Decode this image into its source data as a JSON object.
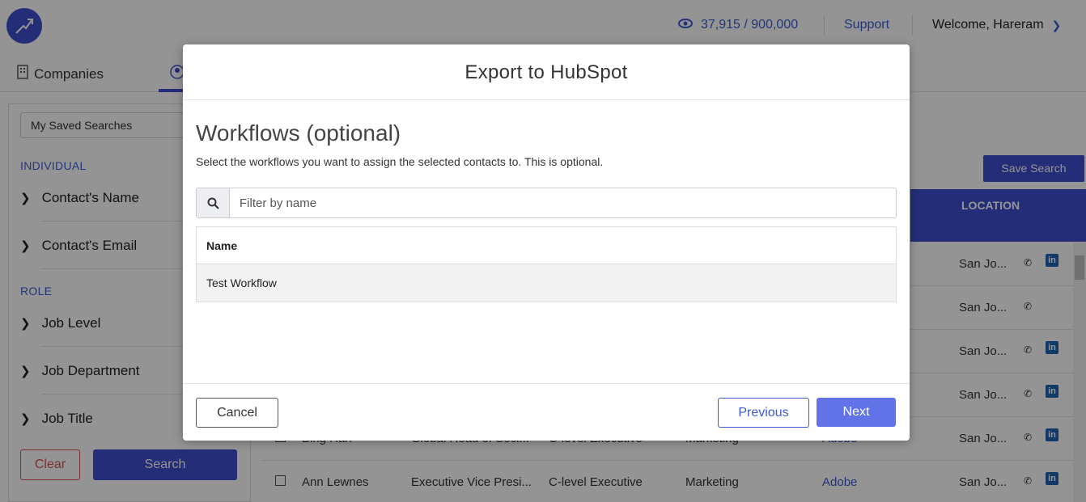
{
  "header": {
    "credits": "37,915 / 900,000",
    "support": "Support",
    "welcome": "Welcome, Hareram"
  },
  "tabs": {
    "companies": "Companies"
  },
  "sidebar": {
    "saved_searches": "My Saved Searches",
    "individual_label": "INDIVIDUAL",
    "role_label": "ROLE",
    "items": [
      "Contact's Name",
      "Contact's Email",
      "Job Level",
      "Job Department",
      "Job Title"
    ],
    "clear": "Clear",
    "search": "Search"
  },
  "main": {
    "save_search": "Save Search",
    "location_header": "LOCATION",
    "rows": [
      {
        "location": "San Jo..."
      },
      {
        "location": "San Jo..."
      },
      {
        "location": "San Jo..."
      },
      {
        "location": "San Jo..."
      },
      {
        "name": "Bing Han",
        "title": "Global Head of Soci...",
        "level": "C-level Executive",
        "dept": "Marketing",
        "company": "Adobe",
        "location": "San Jo..."
      },
      {
        "name": "Ann Lewnes",
        "title": "Executive Vice Presi...",
        "level": "C-level Executive",
        "dept": "Marketing",
        "company": "Adobe",
        "location": "San Jo..."
      }
    ]
  },
  "modal": {
    "title": "Export to HubSpot",
    "section_title": "Workflows (optional)",
    "description": "Select the workflows you want to assign the selected contacts to. This is optional.",
    "filter_placeholder": "Filter by name",
    "table_header": "Name",
    "workflows": [
      "Test Workflow"
    ],
    "cancel": "Cancel",
    "previous": "Previous",
    "next": "Next"
  },
  "colors": {
    "brand": "#3d4fcf",
    "next_button": "#6173e6",
    "danger": "#d9534f"
  }
}
